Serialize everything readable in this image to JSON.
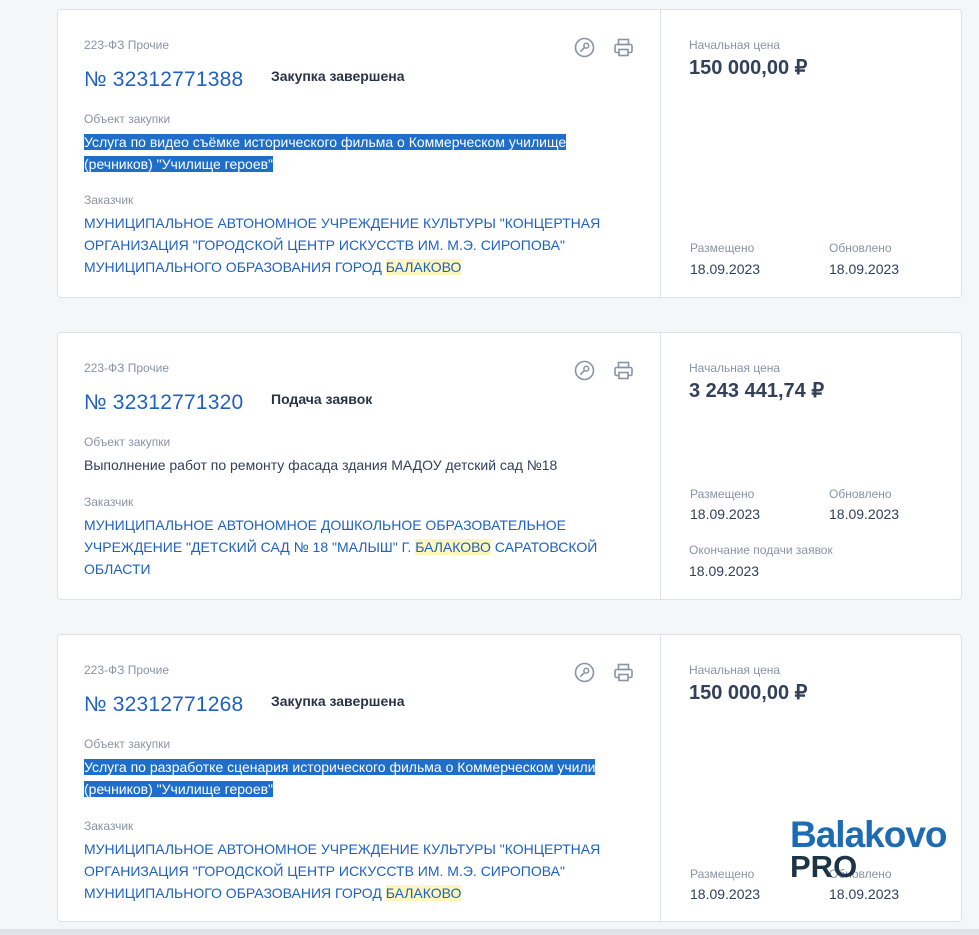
{
  "cards": [
    {
      "law": "223-ФЗ Прочие",
      "number": "№ 32312771388",
      "status": "Закупка завершена",
      "object_label": "Объект закупки",
      "object_line1": "Услуга по видео съёмке исторического фильма о Коммерческом училище",
      "object_line2": "(речников) \"Училище героев\"",
      "customer_label": "Заказчик",
      "customer_line1": "МУНИЦИПАЛЬНОЕ АВТОНОМНОЕ УЧРЕЖДЕНИЕ КУЛЬТУРЫ \"КОНЦЕРТНАЯ",
      "customer_line2": "ОРГАНИЗАЦИЯ \"ГОРОДСКОЙ ЦЕНТР ИСКУССТВ ИМ. М.Э. СИРОПОВА\"",
      "customer_line3a": "МУНИЦИПАЛЬНОГО ОБРАЗОВАНИЯ ГОРОД ",
      "customer_line3b": "БАЛАКОВО",
      "price_label": "Начальная цена",
      "price": "150 000,00 ₽",
      "posted_label": "Размещено",
      "posted": "18.09.2023",
      "updated_label": "Обновлено",
      "updated": "18.09.2023"
    },
    {
      "law": "223-ФЗ Прочие",
      "number": "№ 32312771320",
      "status": "Подача заявок",
      "object_label": "Объект закупки",
      "object_line1": "Выполнение работ по ремонту фасада здания МАДОУ детский сад №18",
      "customer_label": "Заказчик",
      "customer_line1": "МУНИЦИПАЛЬНОЕ АВТОНОМНОЕ ДОШКОЛЬНОЕ ОБРАЗОВАТЕЛЬНОЕ",
      "customer_line2a": "УЧРЕЖДЕНИЕ \"ДЕТСКИЙ САД № 18 \"МАЛЫШ\" Г. ",
      "customer_line2b": "БАЛАКОВО",
      "customer_line2c": " САРАТОВСКОЙ",
      "customer_line3": "ОБЛАСТИ",
      "price_label": "Начальная цена",
      "price": "3 243 441,74 ₽",
      "posted_label": "Размещено",
      "posted": "18.09.2023",
      "updated_label": "Обновлено",
      "updated": "18.09.2023",
      "deadline_label": "Окончание подачи заявок",
      "deadline": "18.09.2023"
    },
    {
      "law": "223-ФЗ Прочие",
      "number": "№ 32312771268",
      "status": "Закупка завершена",
      "object_label": "Объект закупки",
      "object_line1": "Услуга по разработке сценария исторического фильма о Коммерческом учили",
      "object_line2": "(речников) \"Училище героев\"",
      "customer_label": "Заказчик",
      "customer_line1": "МУНИЦИПАЛЬНОЕ АВТОНОМНОЕ УЧРЕЖДЕНИЕ КУЛЬТУРЫ \"КОНЦЕРТНАЯ",
      "customer_line2": "ОРГАНИЗАЦИЯ \"ГОРОДСКОЙ ЦЕНТР ИСКУССТВ ИМ. М.Э. СИРОПОВА\"",
      "customer_line3a": "МУНИЦИПАЛЬНОГО ОБРАЗОВАНИЯ ГОРОД ",
      "customer_line3b": "БАЛАКОВО",
      "price_label": "Начальная цена",
      "price": "150 000,00 ₽",
      "posted_label": "Размещено",
      "posted": "18.09.2023",
      "updated_label": "Обновлено",
      "updated": "18.09.2023"
    }
  ],
  "watermark": {
    "top": "Balakovo",
    "bottom": "PRO"
  },
  "icons": {
    "document": "document-key-icon",
    "print": "printer-icon"
  },
  "colors": {
    "link": "#1f61c2",
    "selection": "#1f6ec9",
    "highlight": "#fdf7bd"
  }
}
